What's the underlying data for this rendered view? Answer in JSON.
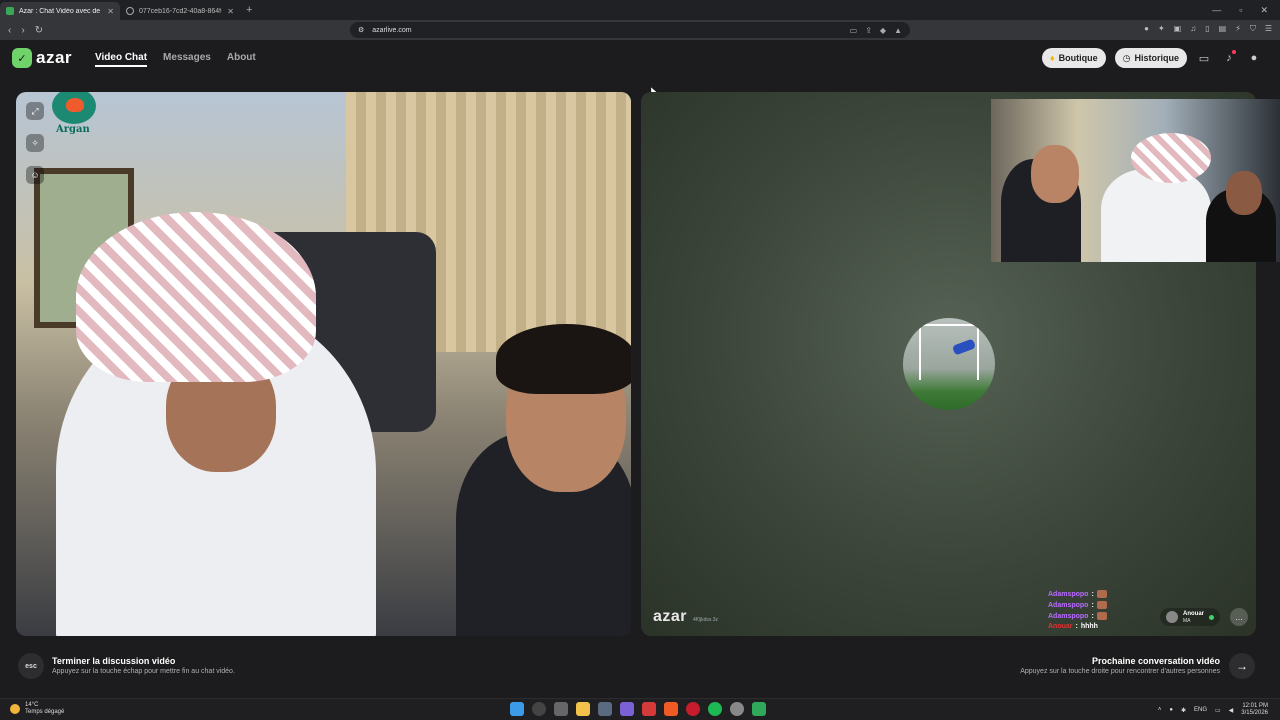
{
  "browser": {
    "tabs": [
      {
        "title": "Azar : Chat Vidéo avec de no"
      },
      {
        "title": "077ceb16-7cd2-40a8-864f-b081f4c"
      }
    ],
    "url": "azarlive.com"
  },
  "app": {
    "logo_text": "azar",
    "nav": [
      "Video Chat",
      "Messages",
      "About"
    ],
    "boutique_label": "Boutique",
    "historique_label": "Historique"
  },
  "left_video": {
    "overlay_logo_text": "Argan"
  },
  "right_video": {
    "watermark": "azar",
    "watermark_id": "4f0jkdss.3z",
    "chat": [
      {
        "user": "Adamspopo",
        "sep": ":",
        "msg": ""
      },
      {
        "user": "Adamspopo",
        "sep": ":",
        "msg": ""
      },
      {
        "user": "Adamspopo",
        "sep": ":",
        "msg": ""
      },
      {
        "user": "Anouar",
        "sep": ":",
        "msg": "hhhh"
      }
    ],
    "partner": {
      "name": "Anouar",
      "country": "MA"
    }
  },
  "footer": {
    "esc_key": "esc",
    "end_title": "Terminer la discussion vidéo",
    "end_sub": "Appuyez sur la touche échap pour mettre fin au chat vidéo.",
    "next_title": "Prochaine conversation vidéo",
    "next_sub": "Appuyez sur la touche droite pour rencontrer d'autres personnes"
  },
  "taskbar": {
    "temp": "14°C",
    "weather": "Temps dégagé",
    "lang": "ENG",
    "time": "12:01 PM",
    "date": "3/15/2026"
  },
  "colors": {
    "accent_green": "#6fd36a",
    "chat_username": "#b86bff",
    "chat_username_red": "#e03232"
  }
}
